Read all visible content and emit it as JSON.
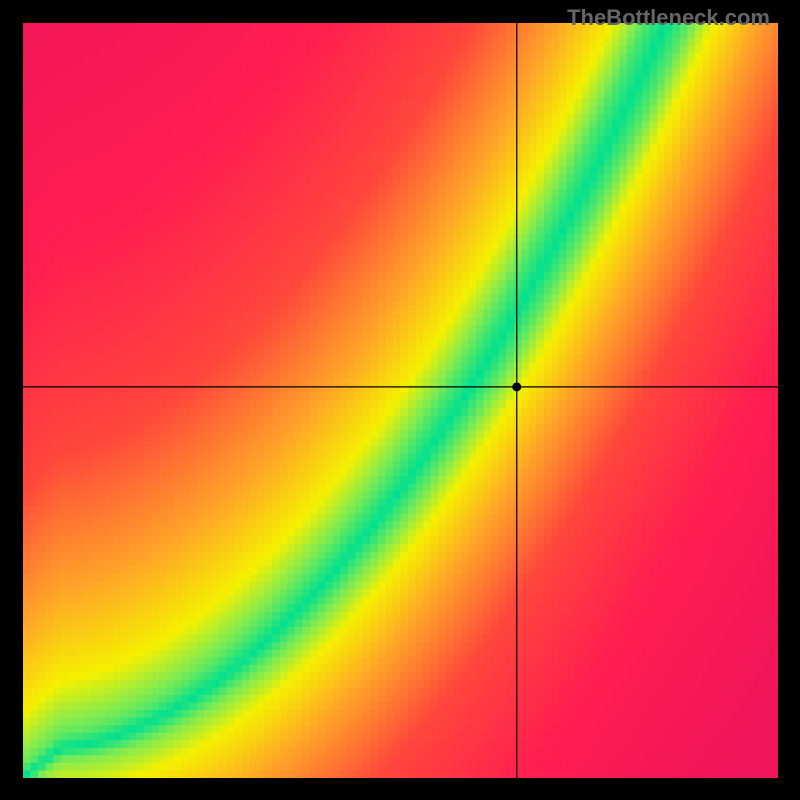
{
  "chart_data": {
    "type": "heatmap",
    "title": "",
    "xlabel": "",
    "ylabel": "",
    "xlim": [
      0,
      1
    ],
    "ylim": [
      0,
      1
    ],
    "crosshair": {
      "x": 0.654,
      "y": 0.518
    },
    "marker": {
      "x": 0.654,
      "y": 0.518
    },
    "optimal_band": {
      "description": "Green diagonal band indicating balanced performance ratio",
      "path_bottom": [
        {
          "x": 0.0,
          "y": 0.0
        },
        {
          "x": 0.15,
          "y": 0.1
        },
        {
          "x": 0.3,
          "y": 0.25
        },
        {
          "x": 0.45,
          "y": 0.45
        },
        {
          "x": 0.6,
          "y": 0.7
        },
        {
          "x": 0.75,
          "y": 0.92
        },
        {
          "x": 0.82,
          "y": 1.0
        }
      ],
      "path_top": [
        {
          "x": 0.0,
          "y": 0.0
        },
        {
          "x": 0.12,
          "y": 0.12
        },
        {
          "x": 0.25,
          "y": 0.28
        },
        {
          "x": 0.4,
          "y": 0.5
        },
        {
          "x": 0.55,
          "y": 0.75
        },
        {
          "x": 0.68,
          "y": 0.95
        },
        {
          "x": 0.72,
          "y": 1.0
        }
      ]
    },
    "color_scale": {
      "optimal": "#00e090",
      "good": "#f5f000",
      "moderate": "#ff9020",
      "poor": "#ff2050"
    }
  },
  "watermark": "TheBottleneck.com",
  "canvas": {
    "size": 755,
    "grid_size": 100
  }
}
